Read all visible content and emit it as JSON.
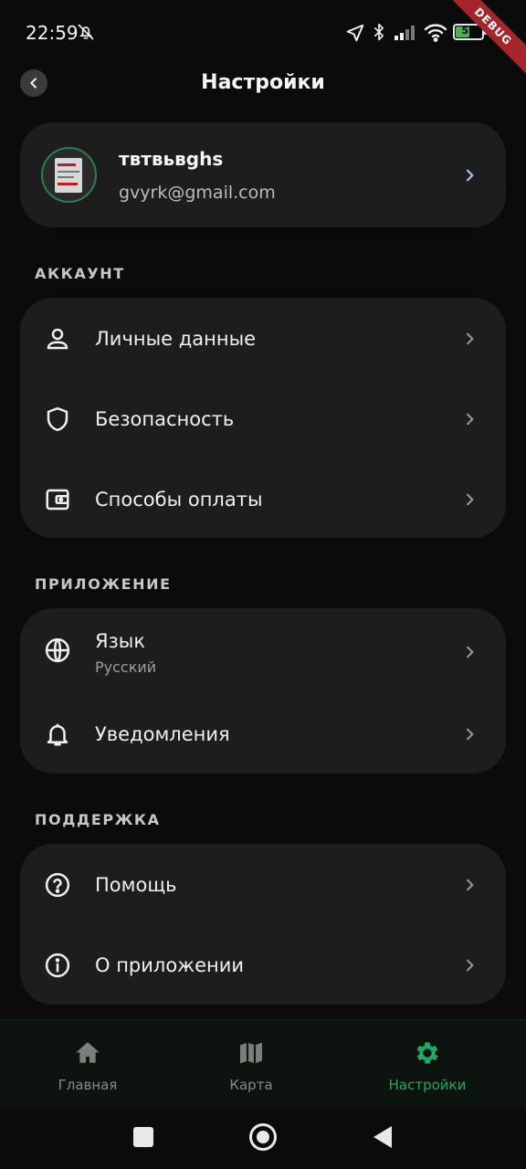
{
  "status_bar": {
    "time": "22:59",
    "battery_level": "52",
    "battery_percent": 52,
    "debug_label": "DEBUG",
    "icons": [
      "bell-off-icon",
      "location-arrow-icon",
      "bluetooth-icon",
      "signal-icon",
      "wifi-icon",
      "battery-icon"
    ]
  },
  "header": {
    "title": "Настройки",
    "back_icon": "chevron-left-icon"
  },
  "profile": {
    "name": "твтвьвghs",
    "email": "gvyrk@gmail.com"
  },
  "sections": {
    "account": {
      "label": "АККАУНТ",
      "items": [
        {
          "label": "Личные данные",
          "icon": "person-icon"
        },
        {
          "label": "Безопасность",
          "icon": "shield-icon"
        },
        {
          "label": "Способы оплаты",
          "icon": "wallet-icon"
        }
      ]
    },
    "app": {
      "label": "ПРИЛОЖЕНИЕ",
      "items": [
        {
          "label": "Язык",
          "sublabel": "Русский",
          "icon": "globe-icon"
        },
        {
          "label": "Уведомления",
          "icon": "bell-icon"
        }
      ]
    },
    "support": {
      "label": "ПОДДЕРЖКА",
      "items": [
        {
          "label": "Помощь",
          "icon": "help-circle-icon"
        },
        {
          "label": "О приложении",
          "icon": "info-icon"
        }
      ]
    }
  },
  "bottom_nav": {
    "items": [
      {
        "label": "Главная",
        "icon": "home-icon",
        "active": false
      },
      {
        "label": "Карта",
        "icon": "map-icon",
        "active": false
      },
      {
        "label": "Настройки",
        "icon": "gear-icon",
        "active": true
      }
    ]
  },
  "colors": {
    "background": "#0b0b0b",
    "card": "#1d1d1d",
    "accent": "#1ea862",
    "chevron_profile": "#9ec3f0",
    "chevron": "#9a9a9a"
  }
}
